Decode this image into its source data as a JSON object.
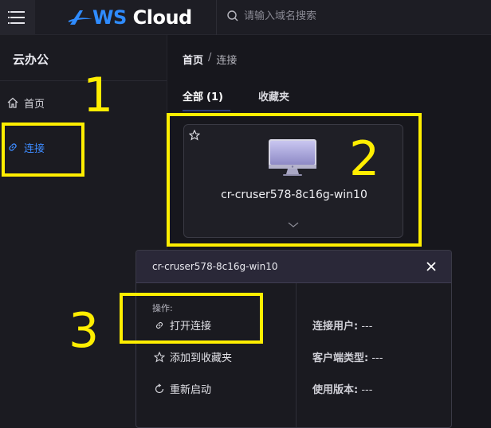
{
  "topbar": {
    "logo_brand": "WS",
    "logo_cloud": "Cloud",
    "search_placeholder": "请输入域名搜索"
  },
  "sidebar": {
    "title": "云办公",
    "items": [
      {
        "label": "首页",
        "icon": "home-icon"
      },
      {
        "label": "连接",
        "icon": "link-icon",
        "active": true
      }
    ]
  },
  "breadcrumb": {
    "home": "首页",
    "separator": "/",
    "current": "连接"
  },
  "tabs": [
    {
      "label": "全部",
      "count": "(1)",
      "active": true
    },
    {
      "label": "收藏夹"
    }
  ],
  "desktop": {
    "name": "cr-cruser578-8c16g-win10"
  },
  "panel": {
    "title": "cr-cruser578-8c16g-win10",
    "ops_label": "操作:",
    "ops": [
      {
        "label": "打开连接",
        "icon": "link-icon"
      },
      {
        "label": "添加到收藏夹",
        "icon": "star-icon"
      },
      {
        "label": "重新启动",
        "icon": "restart-icon"
      }
    ],
    "info": [
      {
        "key": "连接用户:",
        "value": "---"
      },
      {
        "key": "客户端类型:",
        "value": "---"
      },
      {
        "key": "使用版本:",
        "value": "---"
      }
    ]
  },
  "annotations": [
    "1",
    "2",
    "3"
  ],
  "colors": {
    "accent": "#3d8bff",
    "highlight": "#ffee00",
    "background": "#17171d"
  }
}
